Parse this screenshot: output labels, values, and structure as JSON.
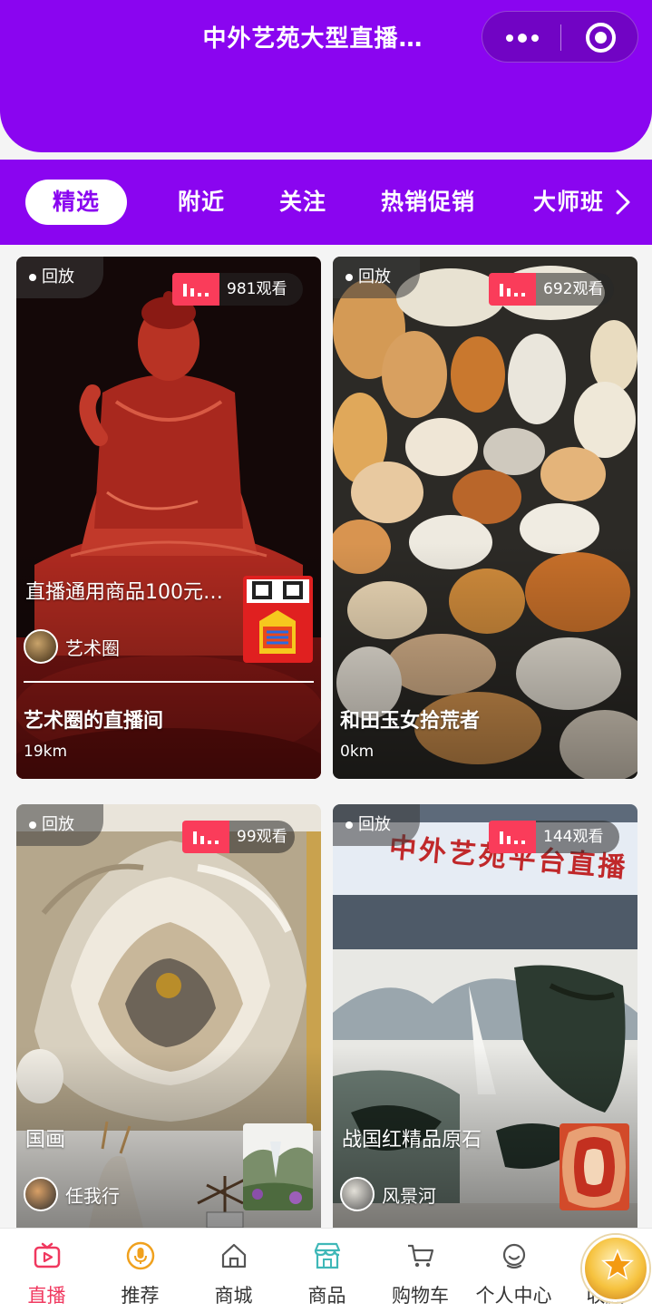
{
  "header": {
    "title": "中外艺苑大型直播…",
    "more_icon": "more-dots-icon",
    "close_icon": "target-close-icon",
    "bg_color": "#8a05f0"
  },
  "tabs": [
    {
      "label": "精选",
      "active": true
    },
    {
      "label": "附近",
      "active": false
    },
    {
      "label": "关注",
      "active": false
    },
    {
      "label": "热销促销",
      "active": false
    },
    {
      "label": "大师班",
      "active": false
    }
  ],
  "cards": [
    {
      "replay": "回放",
      "views": "981观看",
      "goods_title": "直播通用商品100元…",
      "author": "艺术圈",
      "room": "艺术圈的直播间",
      "distance": "19km"
    },
    {
      "replay": "回放",
      "views": "692观看",
      "goods_title": "",
      "author": "",
      "room": "和田玉女拾荒者",
      "distance": "0km"
    },
    {
      "replay": "回放",
      "views": "99观看",
      "goods_title": "国画",
      "author": "任我行",
      "room": "",
      "distance": ""
    },
    {
      "replay": "回放",
      "views": "144观看",
      "goods_title": "战国红精品原石",
      "author": "风景河",
      "room": "",
      "distance": ""
    }
  ],
  "card4_banner": "中外艺苑平台直播",
  "bottom_nav": [
    {
      "label": "直播",
      "icon": "live-tv-icon",
      "active": true
    },
    {
      "label": "推荐",
      "icon": "microphone-icon",
      "active": false
    },
    {
      "label": "商城",
      "icon": "home-icon",
      "active": false
    },
    {
      "label": "商品",
      "icon": "store-icon",
      "active": false
    },
    {
      "label": "购物车",
      "icon": "cart-icon",
      "active": false
    },
    {
      "label": "个人中心",
      "icon": "smile-face-icon",
      "active": false
    },
    {
      "label": "收藏",
      "icon": "",
      "active": false
    }
  ],
  "colors": {
    "accent": "#8a05f0",
    "live_red": "#fa3c5a",
    "nav_active": "#f0385f"
  }
}
